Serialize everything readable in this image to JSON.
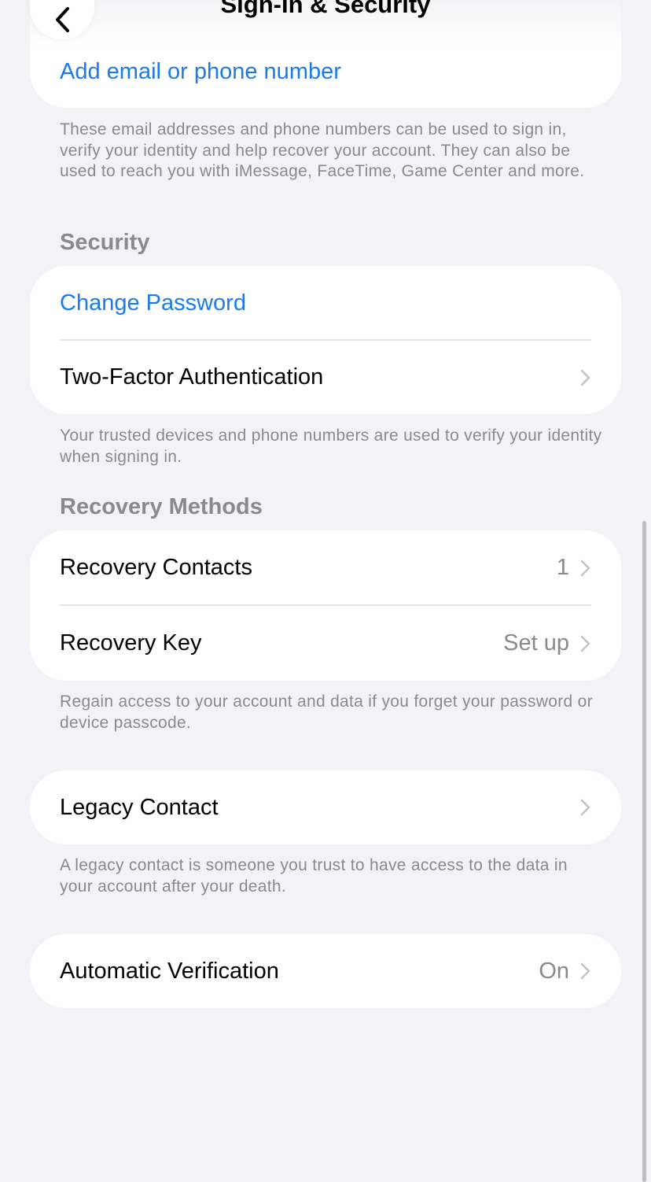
{
  "nav": {
    "title": "Sign-In & Security",
    "back_icon": "chevron-left-icon"
  },
  "contact": {
    "add_label": "Add email or phone number",
    "footnote": "These email addresses and phone numbers can be used to sign in, verify your identity and help recover your account. They can also be used to reach you with iMessage, FaceTime, Game Center and more."
  },
  "security": {
    "header": "Security",
    "change_password": "Change Password",
    "two_factor": "Two-Factor Authentication",
    "footnote": "Your trusted devices and phone numbers are used to verify your identity when signing in."
  },
  "recovery": {
    "header": "Recovery Methods",
    "contacts_label": "Recovery Contacts",
    "contacts_value": "1",
    "key_label": "Recovery Key",
    "key_value": "Set up",
    "footnote": "Regain access to your account and data if you forget your password or device passcode."
  },
  "legacy": {
    "label": "Legacy Contact",
    "footnote": "A legacy contact is someone you trust to have access to the data in your account after your death."
  },
  "verification": {
    "label": "Automatic Verification",
    "value": "On"
  },
  "colors": {
    "accent": "#1a7bf0",
    "background": "#f2f2f7",
    "secondary_text": "#8a8a8e"
  }
}
